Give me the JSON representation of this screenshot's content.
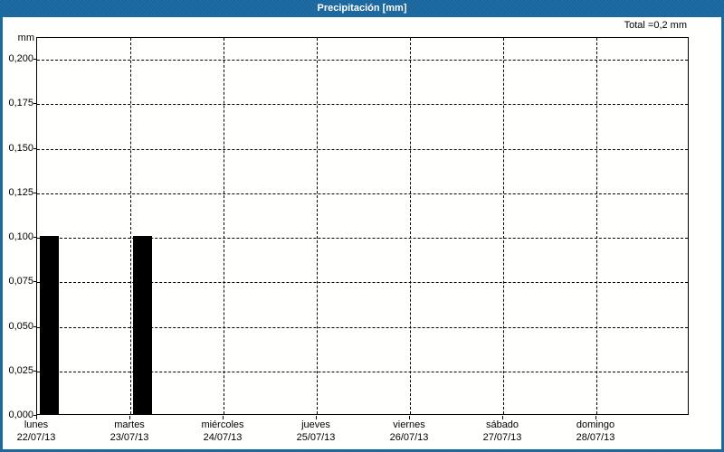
{
  "window": {
    "title": "Precipitación [mm]"
  },
  "chart_data": {
    "type": "bar",
    "title": "Precipitación [mm]",
    "total_label": "Total =0,2 mm",
    "ylabel": "mm",
    "xlabel": "",
    "ylim": [
      0,
      0.2125
    ],
    "grid": "dashed-both-axes",
    "legend": "none",
    "decimal_format": "comma",
    "y_ticks": [
      {
        "label": "0,200",
        "value": 0.2
      },
      {
        "label": "0,175",
        "value": 0.175
      },
      {
        "label": "0,150",
        "value": 0.15
      },
      {
        "label": "0,125",
        "value": 0.125
      },
      {
        "label": "0,100",
        "value": 0.1
      },
      {
        "label": "0,075",
        "value": 0.075
      },
      {
        "label": "0,050",
        "value": 0.05
      },
      {
        "label": "0,025",
        "value": 0.025
      },
      {
        "label": "0,000",
        "value": 0.0
      }
    ],
    "categories": [
      {
        "day": "lunes",
        "date": "22/07/13"
      },
      {
        "day": "martes",
        "date": "23/07/13"
      },
      {
        "day": "miércoles",
        "date": "24/07/13"
      },
      {
        "day": "jueves",
        "date": "25/07/13"
      },
      {
        "day": "viernes",
        "date": "26/07/13"
      },
      {
        "day": "sábado",
        "date": "27/07/13"
      },
      {
        "day": "domingo",
        "date": "28/07/13"
      }
    ],
    "series": [
      {
        "name": "Precipitación",
        "values": [
          0.1,
          0.1,
          0,
          0,
          0,
          0,
          0
        ]
      }
    ],
    "colors": {
      "frame": "#1e6ca4",
      "title_text": "#ffffff",
      "bar": "#000000",
      "grid": "#000000",
      "plot_background": "#fffffd",
      "text": "#000000"
    }
  }
}
